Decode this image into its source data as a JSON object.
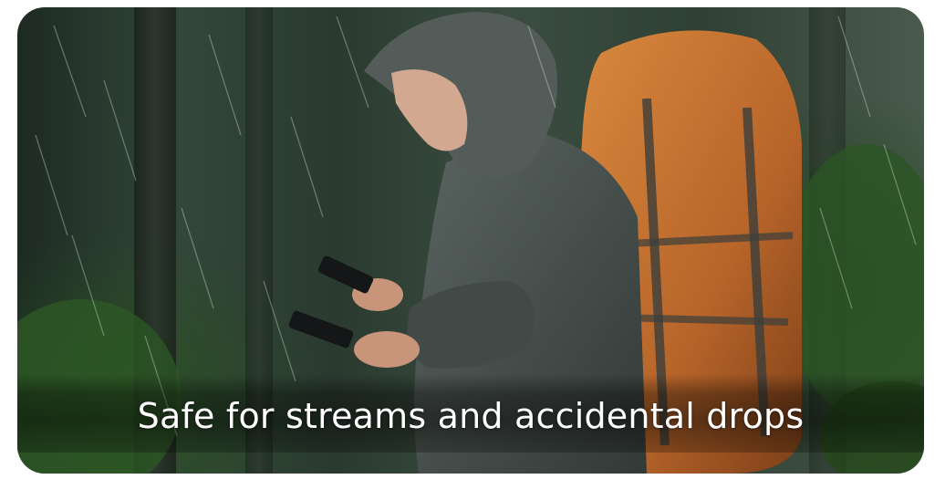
{
  "hero": {
    "caption": "Safe for streams and accidental drops",
    "image_icon": "hiker-in-rain-photo",
    "colors": {
      "caption_text": "#ffffff",
      "backpack_orange": "#c8732c",
      "jacket_gray": "#4a5450",
      "forest_green": "#2f4034"
    }
  }
}
